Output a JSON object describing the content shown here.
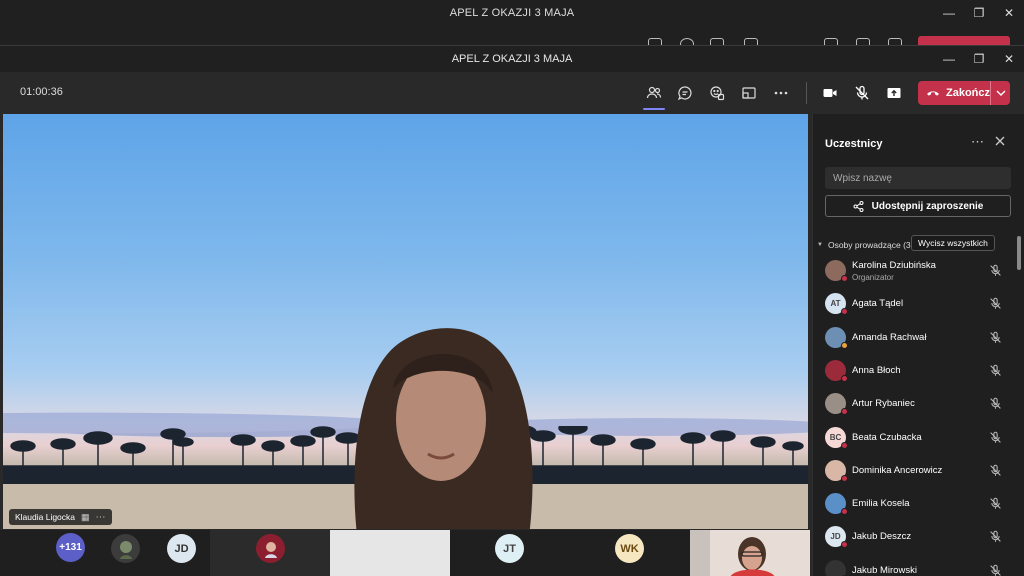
{
  "back_window": {
    "title": "APEL Z OKAZJI 3 MAJA"
  },
  "window": {
    "title": "APEL Z OKAZJI 3 MAJA"
  },
  "toolbar": {
    "timer": "01:00:36",
    "end_label": "Zakończ",
    "icons": [
      "participants-icon",
      "chat-icon",
      "reactions-icon",
      "share-tray-icon",
      "more-icon",
      "camera-icon",
      "mic-off-icon",
      "share-screen-icon"
    ]
  },
  "stage": {
    "speaker_name": "Klaudia Ligocka"
  },
  "gallery": {
    "overflow_count": "+131",
    "tiles": [
      {
        "initials": "JD",
        "color": "#dde7f0"
      },
      {
        "initials": "JT",
        "color": "#dff0f4"
      },
      {
        "initials": "WK",
        "color": "#f6e7c1"
      }
    ]
  },
  "panel": {
    "title": "Uczestnicy",
    "search_placeholder": "Wpisz nazwę",
    "share_label": "Udostępnij zaproszenie",
    "section_label": "Osoby prowadzące (30)",
    "tooltip": "Wycisz wszystkich",
    "participants": [
      {
        "name": "Karolina Dziubińska",
        "role": "Organizator",
        "initials": "",
        "avatar_color": "#8c6a5d"
      },
      {
        "name": "Agata Tądel",
        "role": "",
        "initials": "AT",
        "avatar_color": "#d6e4f2"
      },
      {
        "name": "Amanda Rachwał",
        "role": "",
        "initials": "",
        "avatar_color": "#6d8fb3"
      },
      {
        "name": "Anna Błoch",
        "role": "",
        "initials": "",
        "avatar_color": "#9b2a3a"
      },
      {
        "name": "Artur Rybaniec",
        "role": "",
        "initials": "",
        "avatar_color": "#9a8f86"
      },
      {
        "name": "Beata Czubacka",
        "role": "",
        "initials": "BC",
        "avatar_color": "#f6d9d6"
      },
      {
        "name": "Dominika Ancerowicz",
        "role": "",
        "initials": "",
        "avatar_color": "#d8b7a6"
      },
      {
        "name": "Emilia Kosela",
        "role": "",
        "initials": "",
        "avatar_color": "#5a8fc8"
      },
      {
        "name": "Jakub Deszcz",
        "role": "",
        "initials": "JD",
        "avatar_color": "#dde7f0"
      },
      {
        "name": "Jakub Mirowski",
        "role": "",
        "initials": "",
        "avatar_color": "#333333"
      }
    ]
  }
}
